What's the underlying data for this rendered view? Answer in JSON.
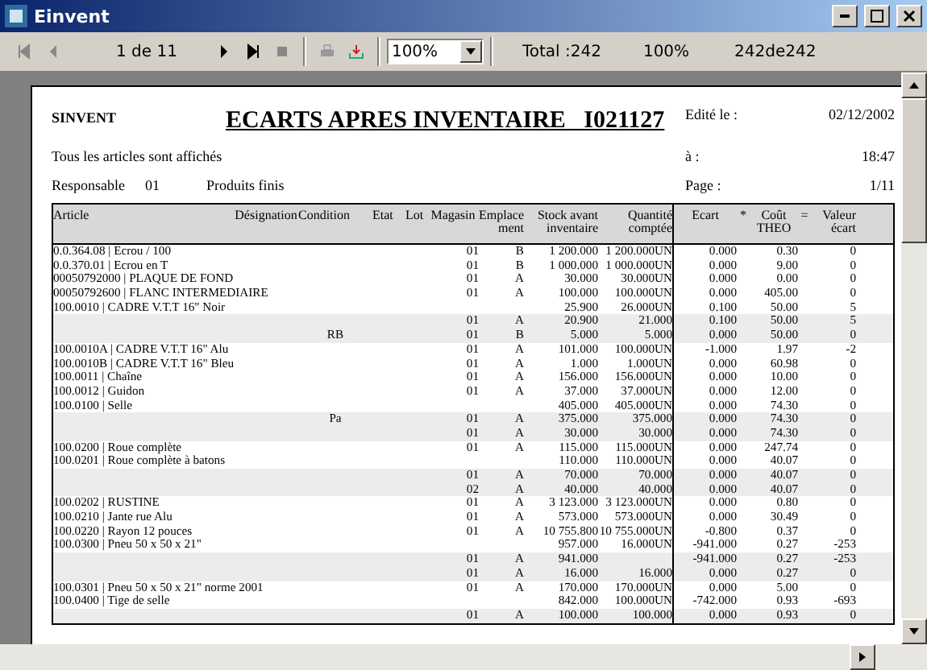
{
  "window": {
    "title": "Einvent"
  },
  "toolbar": {
    "page_indicator": "1 de 11",
    "zoom": "100%",
    "total": "Total :242",
    "percent": "100%",
    "records": "242de242"
  },
  "report": {
    "company": "SINVENT",
    "title": "ECARTS APRES INVENTAIRE   I021127",
    "edited_label": "Edité le :",
    "edited_value": "02/12/2002",
    "time_label": "à :",
    "time_value": "18:47",
    "page_label": "Page :",
    "page_value": "1/11",
    "filter_note": "Tous les articles sont affichés",
    "responsible_label": "Responsable",
    "responsible_code": "01",
    "responsible_name": "Produits finis",
    "columns": [
      {
        "label": "Article"
      },
      {
        "label": "Désignation"
      },
      {
        "label": "Condition"
      },
      {
        "label": "Etat"
      },
      {
        "label": "Lot"
      },
      {
        "label": "Magasin"
      },
      {
        "label": "Emplace ment"
      },
      {
        "label": "Stock avant inventaire"
      },
      {
        "label": "Quantité comptée"
      },
      {
        "label": "Ecart"
      },
      {
        "label": "*"
      },
      {
        "label": "Coût THEO"
      },
      {
        "label": "="
      },
      {
        "label": "Valeur écart"
      }
    ],
    "rows": [
      {
        "shaded": false,
        "article": "0.0.364.08 | Ecrou / 100",
        "condition": "",
        "magasin": "01",
        "emplacement": "B",
        "stock": "1 200.000",
        "counted": "1 200.000UN",
        "ecart": "0.000",
        "cout": "0.30",
        "valeur": "0"
      },
      {
        "shaded": false,
        "article": "0.0.370.01 | Ecrou en T",
        "condition": "",
        "magasin": "01",
        "emplacement": "B",
        "stock": "1 000.000",
        "counted": "1 000.000UN",
        "ecart": "0.000",
        "cout": "9.00",
        "valeur": "0"
      },
      {
        "shaded": false,
        "article": "00050792000 | PLAQUE DE FOND",
        "condition": "",
        "magasin": "01",
        "emplacement": "A",
        "stock": "30.000",
        "counted": "30.000UN",
        "ecart": "0.000",
        "cout": "0.00",
        "valeur": "0"
      },
      {
        "shaded": false,
        "article": "00050792600 | FLANC INTERMEDIAIRE",
        "condition": "",
        "magasin": "01",
        "emplacement": "A",
        "stock": "100.000",
        "counted": "100.000UN",
        "ecart": "0.000",
        "cout": "405.00",
        "valeur": "0"
      },
      {
        "shaded": false,
        "article": "100.0010 | CADRE V.T.T 16\" Noir",
        "condition": "",
        "magasin": "",
        "emplacement": "",
        "stock": "25.900",
        "counted": "26.000UN",
        "ecart": "0.100",
        "cout": "50.00",
        "valeur": "5"
      },
      {
        "shaded": true,
        "article": "",
        "condition": "",
        "magasin": "01",
        "emplacement": "A",
        "stock": "20.900",
        "counted": "21.000",
        "ecart": "0.100",
        "cout": "50.00",
        "valeur": "5"
      },
      {
        "shaded": true,
        "article": "",
        "condition": "RB",
        "magasin": "01",
        "emplacement": "B",
        "stock": "5.000",
        "counted": "5.000",
        "ecart": "0.000",
        "cout": "50.00",
        "valeur": "0"
      },
      {
        "shaded": false,
        "article": "100.0010A | CADRE V.T.T 16\" Alu",
        "condition": "",
        "magasin": "01",
        "emplacement": "A",
        "stock": "101.000",
        "counted": "100.000UN",
        "ecart": "-1.000",
        "cout": "1.97",
        "valeur": "-2"
      },
      {
        "shaded": false,
        "article": "100.0010B | CADRE V.T.T 16\" Bleu",
        "condition": "",
        "magasin": "01",
        "emplacement": "A",
        "stock": "1.000",
        "counted": "1.000UN",
        "ecart": "0.000",
        "cout": "60.98",
        "valeur": "0"
      },
      {
        "shaded": false,
        "article": "100.0011 | Chaîne",
        "condition": "",
        "magasin": "01",
        "emplacement": "A",
        "stock": "156.000",
        "counted": "156.000UN",
        "ecart": "0.000",
        "cout": "10.00",
        "valeur": "0"
      },
      {
        "shaded": false,
        "article": "100.0012 | Guidon",
        "condition": "",
        "magasin": "01",
        "emplacement": "A",
        "stock": "37.000",
        "counted": "37.000UN",
        "ecart": "0.000",
        "cout": "12.00",
        "valeur": "0"
      },
      {
        "shaded": false,
        "article": "100.0100 | Selle",
        "condition": "",
        "magasin": "",
        "emplacement": "",
        "stock": "405.000",
        "counted": "405.000UN",
        "ecart": "0.000",
        "cout": "74.30",
        "valeur": "0"
      },
      {
        "shaded": true,
        "article": "",
        "condition": "Pa",
        "magasin": "01",
        "emplacement": "A",
        "stock": "375.000",
        "counted": "375.000",
        "ecart": "0.000",
        "cout": "74.30",
        "valeur": "0"
      },
      {
        "shaded": true,
        "article": "",
        "condition": "",
        "magasin": "01",
        "emplacement": "A",
        "stock": "30.000",
        "counted": "30.000",
        "ecart": "0.000",
        "cout": "74.30",
        "valeur": "0"
      },
      {
        "shaded": false,
        "article": "100.0200 | Roue complète",
        "condition": "",
        "magasin": "01",
        "emplacement": "A",
        "stock": "115.000",
        "counted": "115.000UN",
        "ecart": "0.000",
        "cout": "247.74",
        "valeur": "0"
      },
      {
        "shaded": false,
        "article": "100.0201 | Roue complète à batons",
        "condition": "",
        "magasin": "",
        "emplacement": "",
        "stock": "110.000",
        "counted": "110.000UN",
        "ecart": "0.000",
        "cout": "40.07",
        "valeur": "0"
      },
      {
        "shaded": true,
        "article": "",
        "condition": "",
        "magasin": "01",
        "emplacement": "A",
        "stock": "70.000",
        "counted": "70.000",
        "ecart": "0.000",
        "cout": "40.07",
        "valeur": "0"
      },
      {
        "shaded": true,
        "article": "",
        "condition": "",
        "magasin": "02",
        "emplacement": "A",
        "stock": "40.000",
        "counted": "40.000",
        "ecart": "0.000",
        "cout": "40.07",
        "valeur": "0"
      },
      {
        "shaded": false,
        "article": "100.0202 | RUSTINE",
        "condition": "",
        "magasin": "01",
        "emplacement": "A",
        "stock": "3 123.000",
        "counted": "3 123.000UN",
        "ecart": "0.000",
        "cout": "0.80",
        "valeur": "0"
      },
      {
        "shaded": false,
        "article": "100.0210 | Jante rue Alu",
        "condition": "",
        "magasin": "01",
        "emplacement": "A",
        "stock": "573.000",
        "counted": "573.000UN",
        "ecart": "0.000",
        "cout": "30.49",
        "valeur": "0"
      },
      {
        "shaded": false,
        "article": "100.0220 | Rayon 12 pouces",
        "condition": "",
        "magasin": "01",
        "emplacement": "A",
        "stock": "10 755.800",
        "counted": "10 755.000UN",
        "ecart": "-0.800",
        "cout": "0.37",
        "valeur": "0"
      },
      {
        "shaded": false,
        "article": "100.0300 | Pneu 50 x 50 x 21\"",
        "condition": "",
        "magasin": "",
        "emplacement": "",
        "stock": "957.000",
        "counted": "16.000UN",
        "ecart": "-941.000",
        "cout": "0.27",
        "valeur": "-253"
      },
      {
        "shaded": true,
        "article": "",
        "condition": "",
        "magasin": "01",
        "emplacement": "A",
        "stock": "941.000",
        "counted": "",
        "ecart": "-941.000",
        "cout": "0.27",
        "valeur": "-253"
      },
      {
        "shaded": true,
        "article": "",
        "condition": "",
        "magasin": "01",
        "emplacement": "A",
        "stock": "16.000",
        "counted": "16.000",
        "ecart": "0.000",
        "cout": "0.27",
        "valeur": "0"
      },
      {
        "shaded": false,
        "article": "100.0301 | Pneu 50 x 50 x 21\" norme 2001",
        "condition": "",
        "magasin": "01",
        "emplacement": "A",
        "stock": "170.000",
        "counted": "170.000UN",
        "ecart": "0.000",
        "cout": "5.00",
        "valeur": "0"
      },
      {
        "shaded": false,
        "article": "100.0400 | Tige de selle",
        "condition": "",
        "magasin": "",
        "emplacement": "",
        "stock": "842.000",
        "counted": "100.000UN",
        "ecart": "-742.000",
        "cout": "0.93",
        "valeur": "-693"
      },
      {
        "shaded": true,
        "article": "",
        "condition": "",
        "magasin": "01",
        "emplacement": "A",
        "stock": "100.000",
        "counted": "100.000",
        "ecart": "0.000",
        "cout": "0.93",
        "valeur": "0"
      }
    ]
  }
}
